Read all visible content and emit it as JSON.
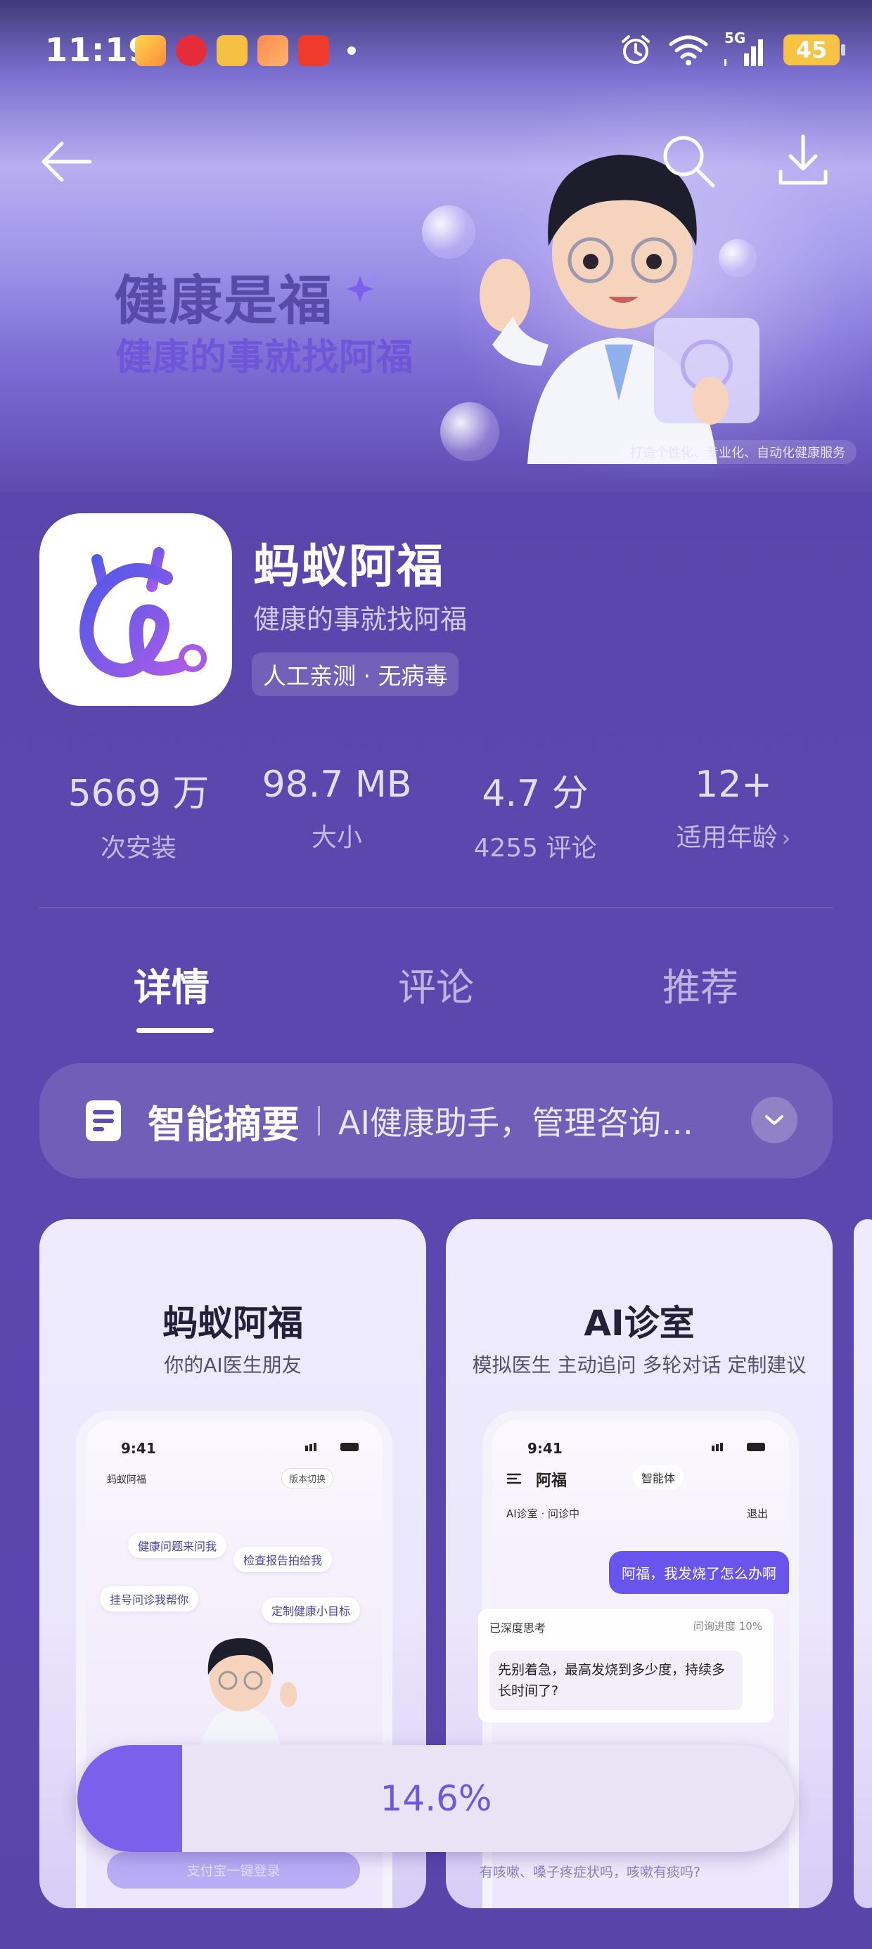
{
  "status_bar": {
    "time": "11:19",
    "network": "5G",
    "battery": "45",
    "notification_icons": [
      "game-app-icon",
      "weibo-red-icon",
      "weibo-icon",
      "gallery-app-icon",
      "video-app-icon"
    ]
  },
  "nav": {
    "back_icon": "arrow-left-icon",
    "search_icon": "search-icon",
    "download_icon": "download-icon"
  },
  "banner": {
    "title": "健康是福",
    "subtitle": "健康的事就找阿福",
    "caption": "打造个性化、专业化、自动化健康服务"
  },
  "app": {
    "name": "蚂蚁阿福",
    "slogan": "健康的事就找阿福",
    "badge": "人工亲测 · 无病毒"
  },
  "stats": [
    {
      "value": "5669 万",
      "label": "次安装"
    },
    {
      "value": "98.7 MB",
      "label": "大小"
    },
    {
      "value": "4.7 分",
      "label": "4255 评论"
    },
    {
      "value": "12+",
      "label": "适用年龄"
    }
  ],
  "tabs": [
    {
      "label": "详情",
      "active": true
    },
    {
      "label": "评论",
      "active": false
    },
    {
      "label": "推荐",
      "active": false
    }
  ],
  "summary": {
    "title": "智能摘要",
    "text": "AI健康助手，管理咨询…"
  },
  "screenshots": [
    {
      "title": "蚂蚁阿福",
      "subtitle": "你的AI医生朋友",
      "phone_time": "9:41",
      "logo_text": "蚂蚁阿福",
      "switch_text": "版本切换",
      "chips": [
        "健康问题来问我",
        "检查报告拍给我",
        "挂号问诊我帮你",
        "定制健康小目标"
      ],
      "login_text": "支付宝一键登录"
    },
    {
      "title": "AI诊室",
      "subtitle": "模拟医生 主动追问 多轮对话 定制建议",
      "phone_time": "9:41",
      "header_title": "阿福",
      "agent_label": "智能体",
      "ai_room": "AI诊室 · 问诊中",
      "exit": "退出",
      "user_message": "阿福，我发烧了怎么办啊",
      "think_label": "已深度思考",
      "progress_label": "问询进度 10%",
      "reply": "先别着急，最高发烧到多少度，持续多长时间了?",
      "bottom_question": "有咳嗽、嗓子疼症状吗，咳嗽有痰吗?"
    }
  ],
  "download": {
    "progress": 0.146,
    "progress_text": "14.6%"
  },
  "colors": {
    "accent": "#7a61ec",
    "background": "#5a47ad",
    "battery": "#f6c343"
  }
}
